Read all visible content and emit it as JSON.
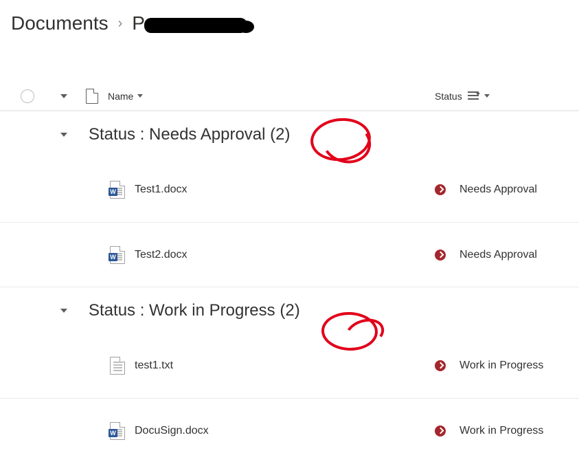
{
  "breadcrumb": {
    "root": "Documents",
    "current": "P"
  },
  "columns": {
    "name": "Name",
    "status": "Status"
  },
  "groups": [
    {
      "label_prefix": "Status : ",
      "label_value": "Needs Approval",
      "count": 2,
      "items": [
        {
          "icon": "word",
          "name": "Test1.docx",
          "status": "Needs Approval"
        },
        {
          "icon": "word",
          "name": "Test2.docx",
          "status": "Needs Approval"
        }
      ]
    },
    {
      "label_prefix": "Status : ",
      "label_value": "Work in Progress",
      "count": 2,
      "items": [
        {
          "icon": "txt",
          "name": "test1.txt",
          "status": "Work in Progress"
        },
        {
          "icon": "word",
          "name": "DocuSign.docx",
          "status": "Work in Progress"
        }
      ]
    }
  ]
}
